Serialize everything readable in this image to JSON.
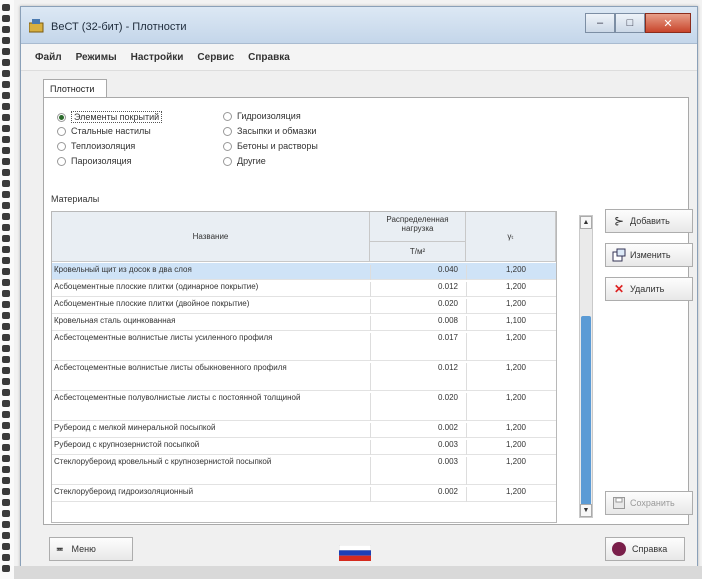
{
  "window": {
    "title": "ВеСТ (32-бит) - Плотности"
  },
  "menu": [
    "Файл",
    "Режимы",
    "Настройки",
    "Сервис",
    "Справка"
  ],
  "tab": "Плотности",
  "radios": {
    "left": [
      "Элементы покрытий",
      "Стальные настилы",
      "Теплоизоляция",
      "Пароизоляция"
    ],
    "right": [
      "Гидроизоляция",
      "Засыпки и обмазки",
      "Бетоны и растворы",
      "Другие"
    ],
    "selected": "Элементы покрытий"
  },
  "materials_label": "Материалы",
  "table": {
    "col_name": "Название",
    "col_load": "Распределенная нагрузка",
    "col_load_unit": "Т/м²",
    "col_gamma": "γₜ",
    "rows": [
      {
        "name": "Кровельный щит из досок в два слоя",
        "load": "0.040",
        "gamma": "1,200"
      },
      {
        "name": "Асбоцементные плоские плитки (одинарное покрытие)",
        "load": "0.012",
        "gamma": "1,200"
      },
      {
        "name": "Асбоцементные плоские плитки (двойное покрытие)",
        "load": "0.020",
        "gamma": "1,200"
      },
      {
        "name": "Кровельная сталь оцинкованная",
        "load": "0.008",
        "gamma": "1,100"
      },
      {
        "name": "Асбестоцементные волнистые листы усиленного профиля",
        "load": "0.017",
        "gamma": "1,200"
      },
      {
        "name": "Асбестоцементные волнистые листы обыкновенного профиля",
        "load": "0.012",
        "gamma": "1,200"
      },
      {
        "name": "Асбестоцементные полуволнистые листы с постоянной толщиной",
        "load": "0.020",
        "gamma": "1,200"
      },
      {
        "name": "Рубероид с мелкой минеральной посыпкой",
        "load": "0.002",
        "gamma": "1,200"
      },
      {
        "name": "Рубероид с крупнозернистой посыпкой",
        "load": "0.003",
        "gamma": "1,200"
      },
      {
        "name": "Стеклорубероид кровельный с крупнозернистой посыпкой",
        "load": "0.003",
        "gamma": "1,200"
      },
      {
        "name": "Стеклорубероид гидроизоляционный",
        "load": "0.002",
        "gamma": "1,200"
      }
    ]
  },
  "actions": {
    "add": "Добавить",
    "edit": "Изменить",
    "delete": "Удалить",
    "save": "Сохранить"
  },
  "bottom": {
    "menu": "Меню",
    "help": "Справка"
  },
  "colors": {
    "selection": "#cfe3f7",
    "scroll_thumb": "#5b9bd5",
    "delete_red": "#d22"
  }
}
